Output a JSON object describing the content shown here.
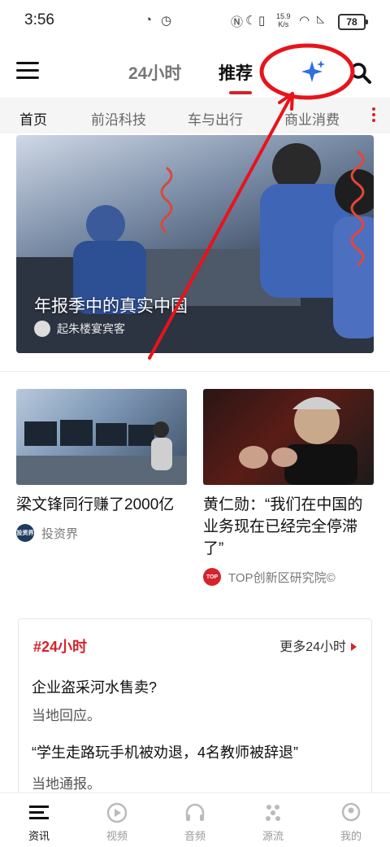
{
  "status": {
    "time": "3:56",
    "speed_value": "15.9",
    "speed_unit": "K/s",
    "battery": "78"
  },
  "header": {
    "tab_24h": "24小时",
    "tab_recommend": "推荐",
    "sparkle_icon": "sparkle-icon",
    "search_icon": "search-icon"
  },
  "categories": [
    "首页",
    "前沿科技",
    "车与出行",
    "商业消费"
  ],
  "hero": {
    "title": "年报季中的真实中国",
    "source": "起朱楼宴宾客"
  },
  "cards": [
    {
      "title": "梁文锋同行赚了2000亿",
      "source": "投资界",
      "avatar_text": "投资界"
    },
    {
      "title": "黄仁勋：“我们在中国的业务现在已经完全停滞了”",
      "source": "TOP创新区研究院©",
      "avatar_text": "TOP"
    }
  ],
  "box24": {
    "title": "#24小时",
    "more": "更多24小时",
    "items": [
      {
        "q": "企业盗采河水售卖?",
        "a": "当地回应。"
      },
      {
        "q": "“学生走路玩手机被劝退，4名教师被辞退”",
        "a": "当地通报。"
      }
    ]
  },
  "nav": [
    "资讯",
    "视频",
    "音频",
    "源流",
    "我的"
  ],
  "colors": {
    "accent": "#d4232b",
    "annotation": "#e8131b",
    "sparkle": "#2f6fe0"
  }
}
